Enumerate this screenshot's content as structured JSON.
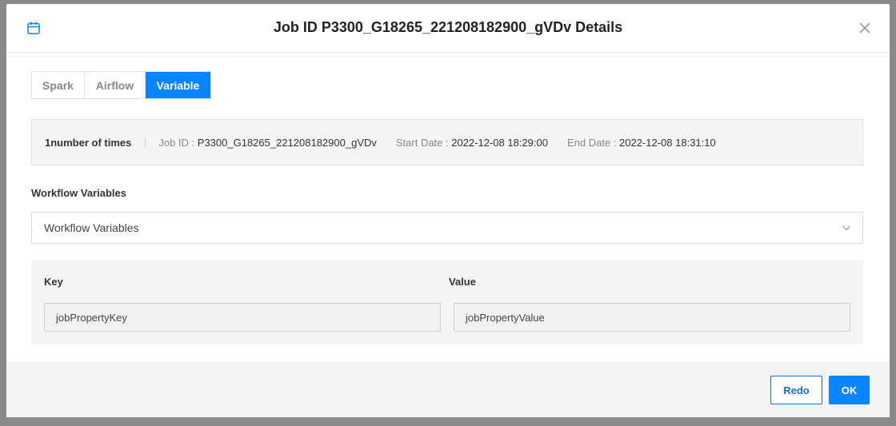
{
  "dialog": {
    "title": "Job ID P3300_G18265_221208182900_gVDv Details"
  },
  "tabs": [
    {
      "label": "Spark"
    },
    {
      "label": "Airflow"
    },
    {
      "label": "Variable",
      "active": true
    }
  ],
  "info": {
    "count": "1number of times",
    "job_id_label": "Job ID : ",
    "job_id_value": "P3300_G18265_221208182900_gVDv",
    "start_label": "Start Date : ",
    "start_value": "2022-12-08 18:29:00",
    "end_label": "End Date : ",
    "end_value": "2022-12-08 18:31:10"
  },
  "workflow": {
    "label": "Workflow Variables",
    "selected": "Workflow Variables"
  },
  "kv": {
    "key_header": "Key",
    "value_header": "Value",
    "key_value": "jobPropertyKey",
    "value_value": "jobPropertyValue"
  },
  "footer": {
    "redo_label": "Redo",
    "ok_label": "OK"
  },
  "colors": {
    "accent": "#0a84ff",
    "redo_border": "#1a6fd0",
    "panel_bg": "#f5f5f6"
  },
  "icons": {
    "header_icon": "calendar-icon",
    "close_icon": "close-icon",
    "select_icon": "chevron-down-icon"
  }
}
